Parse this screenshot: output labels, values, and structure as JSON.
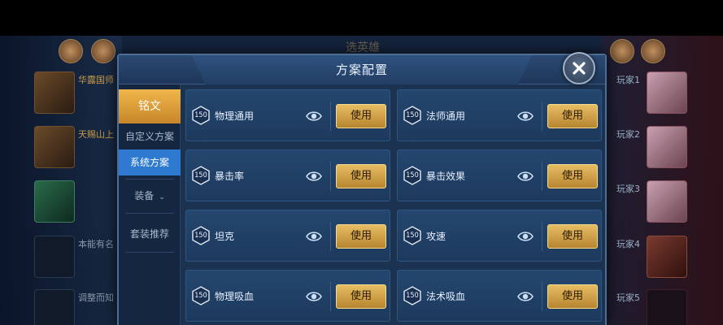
{
  "background": {
    "top_title": "选英雄",
    "left_players": [
      "华露国师",
      "天赐山上",
      "",
      "本能有名",
      "调整而知"
    ],
    "right_players": [
      "玩家1",
      "玩家2",
      "玩家3",
      "玩家4",
      "玩家5"
    ]
  },
  "dialog": {
    "title": "方案配置",
    "close_icon": "close-x-icon"
  },
  "sidebar": {
    "items": [
      {
        "label": "铭文"
      },
      {
        "label": "自定义方案"
      },
      {
        "label": "系统方案"
      },
      {
        "label": "装备",
        "chevron": "⌄"
      },
      {
        "label": "套装推荐"
      }
    ]
  },
  "cards": [
    {
      "level": "150",
      "name": "物理通用",
      "button": "使用"
    },
    {
      "level": "150",
      "name": "法师通用",
      "button": "使用"
    },
    {
      "level": "150",
      "name": "暴击率",
      "button": "使用"
    },
    {
      "level": "150",
      "name": "暴击效果",
      "button": "使用"
    },
    {
      "level": "150",
      "name": "坦克",
      "button": "使用"
    },
    {
      "level": "150",
      "name": "攻速",
      "button": "使用"
    },
    {
      "level": "150",
      "name": "物理吸血",
      "button": "使用"
    },
    {
      "level": "150",
      "name": "法术吸血",
      "button": "使用"
    }
  ],
  "colors": {
    "accent_gold": "#e7bd63",
    "active_blue": "#2e7ad0",
    "panel": "#1b3250"
  }
}
